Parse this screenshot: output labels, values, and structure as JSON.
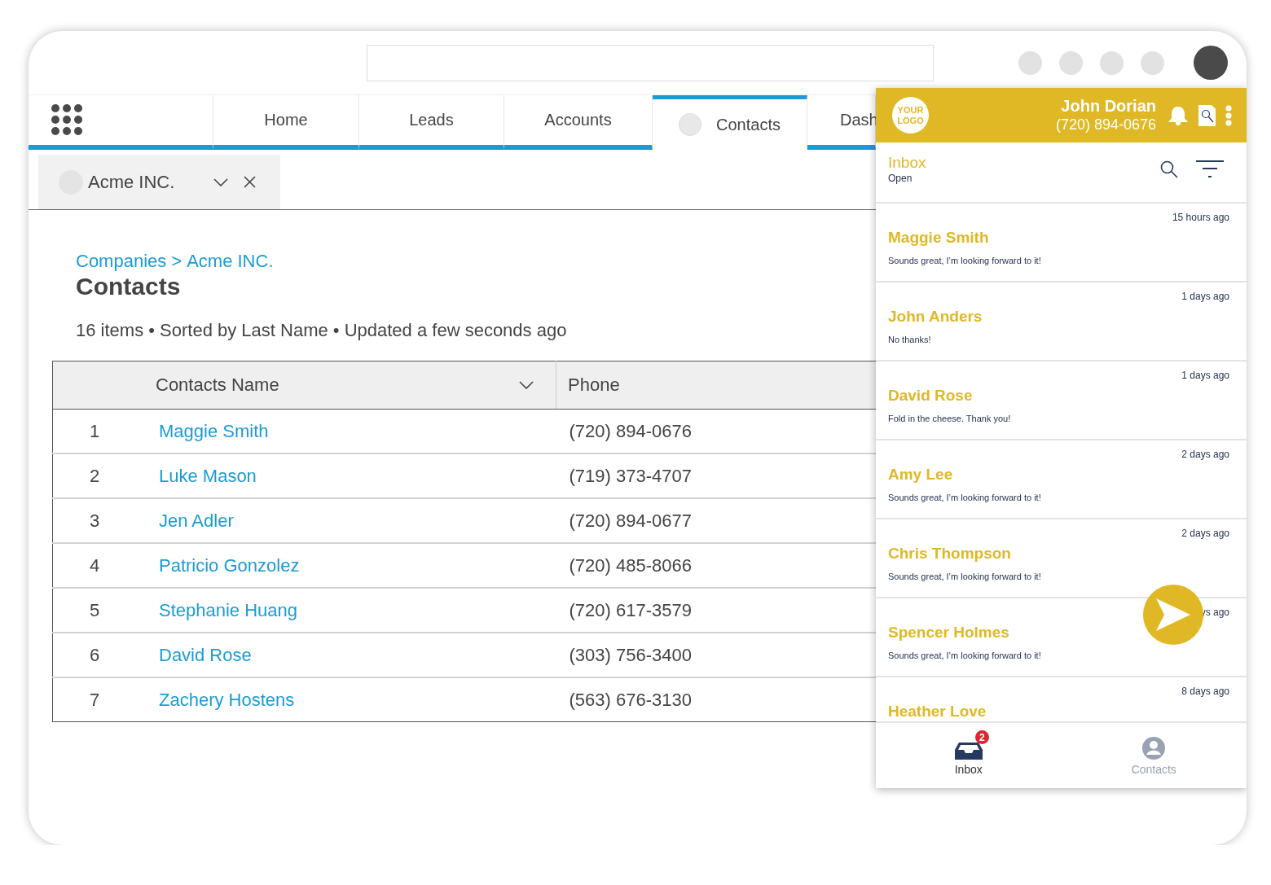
{
  "nav": {
    "tabs": [
      {
        "label": "Home",
        "selected": false,
        "kind": "text"
      },
      {
        "label": "Leads",
        "selected": false,
        "kind": "text"
      },
      {
        "label": "Accounts",
        "selected": false,
        "kind": "text"
      },
      {
        "label": "Contacts",
        "selected": true,
        "kind": "icon"
      },
      {
        "label": "Dash",
        "selected": false,
        "kind": "text"
      }
    ]
  },
  "record_tabs": [
    {
      "label": "Acme INC.",
      "selected": true
    }
  ],
  "breadcrumb": {
    "items": [
      "Companies",
      "Acme INC."
    ],
    "separator": ">"
  },
  "title": "Contacts",
  "summary": "16 items • Sorted by Last Name • Updated a few seconds ago",
  "table": {
    "columns": [
      {
        "label": "Contacts Name",
        "dropdown": true
      },
      {
        "label": "Phone",
        "dropdown": false
      }
    ],
    "rows": [
      {
        "number": "1",
        "name": "Maggie Smith",
        "phone": "(720) 894-0676"
      },
      {
        "number": "2",
        "name": "Luke Mason",
        "phone": "(719) 373-4707"
      },
      {
        "number": "3",
        "name": "Jen Adler",
        "phone": "(720) 894-0677"
      },
      {
        "number": "4",
        "name": "Patricio Gonzolez",
        "phone": "(720) 485-8066"
      },
      {
        "number": "5",
        "name": "Stephanie Huang",
        "phone": "(720) 617-3579"
      },
      {
        "number": "6",
        "name": "David Rose",
        "phone": "(303) 756-3400"
      },
      {
        "number": "7",
        "name": "Zachery Hostens",
        "phone": "(563) 676-3130"
      }
    ]
  },
  "panel": {
    "logo": "YOUR LOGO",
    "user_name": "John Dorian",
    "user_phone": "(720) 894-0676",
    "inbox_title": "Inbox",
    "inbox_filter": "Open",
    "messages": [
      {
        "name": "Maggie Smith",
        "preview": "Sounds great, I’m looking forward to it!",
        "time": "15 hours ago"
      },
      {
        "name": "John Anders",
        "preview": "No thanks!",
        "time": "1 days ago"
      },
      {
        "name": "David Rose",
        "preview": "Fold in the cheese. Thank you!",
        "time": "1 days ago"
      },
      {
        "name": "Amy Lee",
        "preview": "Sounds great, I’m looking forward to it!",
        "time": "2 days ago"
      },
      {
        "name": "Chris Thompson",
        "preview": "Sounds great, I’m looking forward to it!",
        "time": "2 days ago"
      },
      {
        "name": "Spencer Holmes",
        "preview": "Sounds great, I’m looking forward to it!",
        "time": "ys ago"
      },
      {
        "name": "Heather Love",
        "time": "8 days ago"
      }
    ],
    "bottom_nav": [
      {
        "label": "Inbox",
        "selected": true,
        "badge": "2",
        "kind": "inbox"
      },
      {
        "label": "Contacts",
        "selected": false,
        "kind": "contacts"
      }
    ]
  }
}
